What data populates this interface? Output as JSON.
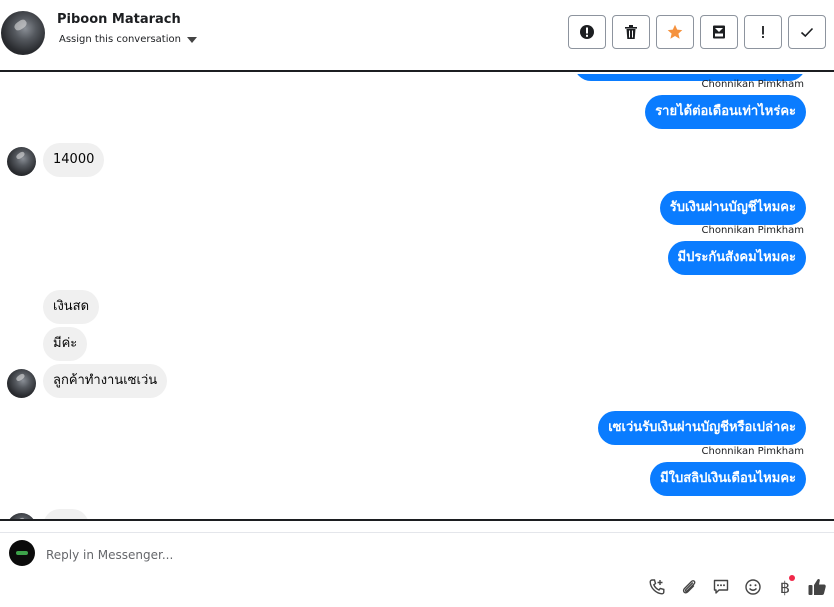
{
  "header": {
    "contact_name": "Piboon Matarach",
    "assign_label": "Assign this conversation",
    "toolbar": [
      {
        "name": "spam-button",
        "icon": "alert-circle-icon"
      },
      {
        "name": "delete-button",
        "icon": "trash-icon"
      },
      {
        "name": "star-button",
        "icon": "star-icon"
      },
      {
        "name": "archive-button",
        "icon": "archive-icon"
      },
      {
        "name": "mark-important-button",
        "icon": "exclamation-icon"
      },
      {
        "name": "mark-done-button",
        "icon": "check-icon"
      }
    ]
  },
  "messages": [
    {
      "direction": "outgoing",
      "text": "รายได้ต่อเดือนเท่าไหร่คะ"
    },
    {
      "direction": "incoming",
      "text": "14000"
    },
    {
      "direction": "outgoing",
      "text": "รับเงินผ่านบัญชีไหมคะ"
    },
    {
      "direction": "outgoing",
      "text": "มีประกันสังคมไหมคะ"
    },
    {
      "direction": "incoming",
      "text": "เงินสด"
    },
    {
      "direction": "incoming",
      "text": "มีค่ะ"
    },
    {
      "direction": "incoming",
      "text": "ลูกค้าทำงานเซเว่น"
    },
    {
      "direction": "outgoing",
      "text": "เซเว่นรับเงินผ่านบัญชีหรือเปล่าคะ"
    },
    {
      "direction": "outgoing",
      "text": "มีใบสลิปเงินเดือนไหมคะ"
    }
  ],
  "sender_labels": [
    "Chonnikan Pimkham",
    "Chonnikan Pimkham",
    "Chonnikan Pimkham"
  ],
  "composer": {
    "placeholder": "Reply in Messenger...",
    "icons": [
      "phone-plus-icon",
      "attachment-icon",
      "saved-reply-icon",
      "emoji-icon",
      "baht-payment-icon",
      "thumbs-up-icon"
    ],
    "baht_symbol": "฿"
  },
  "colors": {
    "outgoing_bubble": "#0a7cff",
    "incoming_bubble": "#f0f0f0",
    "star": "#f5923e",
    "notification_dot": "#f02849"
  }
}
